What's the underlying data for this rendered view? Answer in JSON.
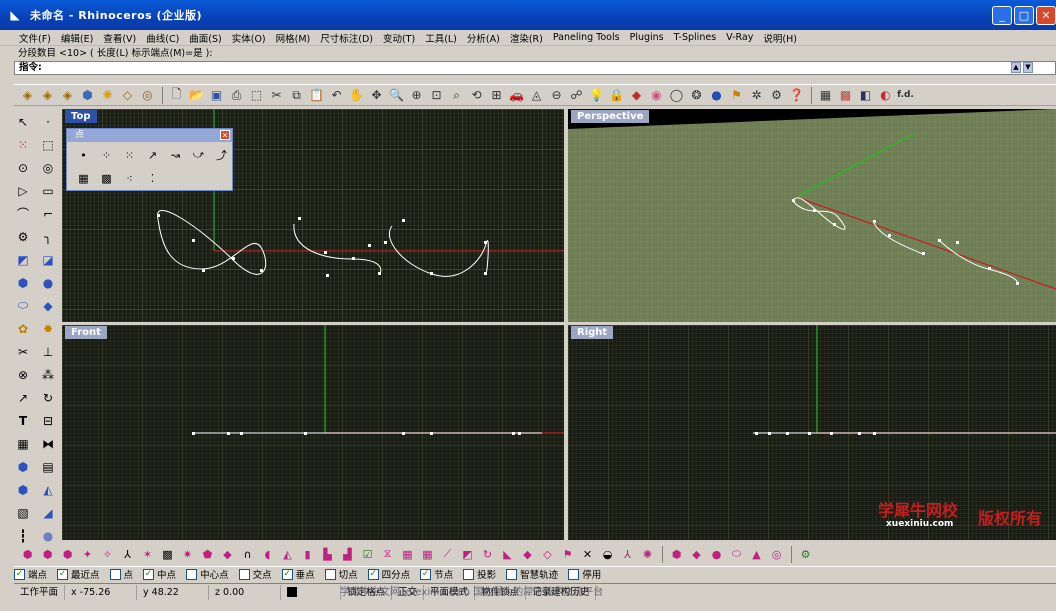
{
  "window": {
    "title": "未命名 - Rhinoceros (企业版)",
    "min_glyph": "_",
    "max_glyph": "□",
    "close_glyph": "✕"
  },
  "menu": [
    "文件(F)",
    "编辑(E)",
    "查看(V)",
    "曲线(C)",
    "曲面(S)",
    "实体(O)",
    "网格(M)",
    "尺寸标注(D)",
    "变动(T)",
    "工具(L)",
    "分析(A)",
    "渲染(R)",
    "Paneling Tools",
    "Plugins",
    "T-Splines",
    "V-Ray",
    "说明(H)"
  ],
  "command": {
    "history": "分段数目 <10> ( 长度(L)  标示端点(M)=是 ):",
    "prompt": "指令:"
  },
  "viewports": {
    "top": "Top",
    "perspective": "Perspective",
    "front": "Front",
    "right": "Right"
  },
  "point_panel": {
    "title": "点",
    "close_glyph": "✕",
    "buttons": [
      "•",
      "⁘",
      "⁙",
      "↗",
      "↝",
      "⤻",
      "⤴",
      "▦",
      "▩",
      "⁖",
      "⁚"
    ]
  },
  "osnaps": [
    {
      "label": "端点",
      "checked": true
    },
    {
      "label": "最近点",
      "checked": true
    },
    {
      "label": "点",
      "checked": false
    },
    {
      "label": "中点",
      "checked": true
    },
    {
      "label": "中心点",
      "checked": false
    },
    {
      "label": "交点",
      "checked": false
    },
    {
      "label": "垂点",
      "checked": true
    },
    {
      "label": "切点",
      "checked": false
    },
    {
      "label": "四分点",
      "checked": true
    },
    {
      "label": "节点",
      "checked": true
    },
    {
      "label": "投影",
      "checked": false
    },
    {
      "label": "智慧轨迹",
      "checked": false
    },
    {
      "label": "停用",
      "checked": false
    }
  ],
  "status": {
    "cplane": "工作平面",
    "x": "x -75.26",
    "y": "y 48.22",
    "z": "z 0.00",
    "grid_snap": "锁定格点",
    "ortho": "正交",
    "planar": "平面模式",
    "osnap": "物件锁点",
    "history": "记录建构历史"
  },
  "watermark": {
    "brand": "学犀牛网校",
    "site": "xuexiniu.com",
    "rights": "版权所有",
    "footer": "学犀牛中文网 xuexiniu.com 国内最大的犀牛技术交流平台"
  },
  "colors": {
    "title_bar": "#0a5bd8",
    "viewport_bg": "#1a1d14",
    "grid_minor": "#3a4230",
    "perspective_grid": "#6f7f55",
    "x_axis": "#b02020",
    "y_axis": "#20b020",
    "curve": "#ffffff",
    "watermark_red": "#c02020"
  }
}
